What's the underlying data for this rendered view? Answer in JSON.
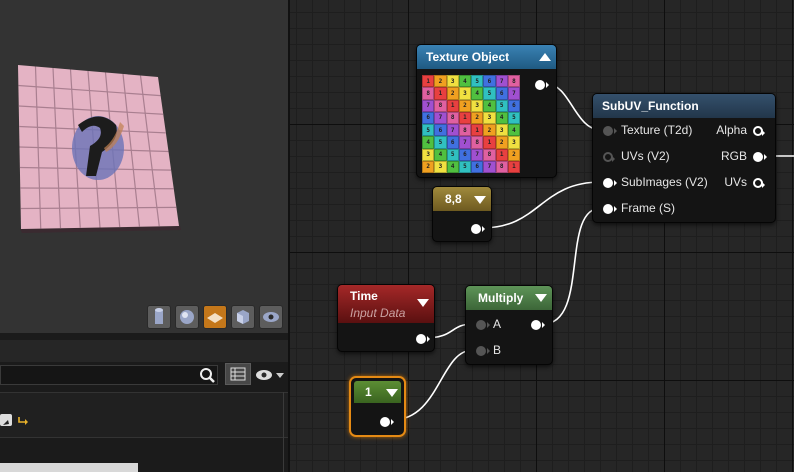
{
  "nodes": {
    "texture_object": {
      "title": "Texture Object"
    },
    "subuv": {
      "title": "SubUV_Function",
      "inputs": [
        "Texture (T2d)",
        "UVs (V2)",
        "SubImages (V2)",
        "Frame (S)"
      ],
      "outputs": [
        "Alpha",
        "RGB",
        "UVs"
      ]
    },
    "constant2": {
      "value": "8,8"
    },
    "time": {
      "title": "Time",
      "subtitle": "Input Data"
    },
    "multiply": {
      "title": "Multiply",
      "inputs": [
        "A",
        "B"
      ]
    },
    "constant1": {
      "value": "1"
    }
  },
  "texture_grid": [
    [
      "1",
      "2",
      "3",
      "4",
      "5",
      "6",
      "7",
      "8"
    ],
    [
      "8",
      "1",
      "2",
      "3",
      "4",
      "5",
      "6",
      "7"
    ],
    [
      "7",
      "8",
      "1",
      "2",
      "3",
      "4",
      "5",
      "6"
    ],
    [
      "6",
      "7",
      "8",
      "1",
      "2",
      "3",
      "4",
      "5"
    ],
    [
      "5",
      "6",
      "7",
      "8",
      "1",
      "2",
      "3",
      "4"
    ],
    [
      "4",
      "5",
      "6",
      "7",
      "8",
      "1",
      "2",
      "3"
    ],
    [
      "3",
      "4",
      "5",
      "6",
      "7",
      "8",
      "1",
      "2"
    ],
    [
      "2",
      "3",
      "4",
      "5",
      "6",
      "7",
      "8",
      "1"
    ]
  ],
  "texture_colors": [
    "#e84040",
    "#f0a020",
    "#f0e040",
    "#50c040",
    "#30c0c0",
    "#4070e0",
    "#a050d0",
    "#e060a0"
  ],
  "viewport": {
    "buttons": [
      "cylinder-icon",
      "sphere-icon",
      "plane-icon",
      "cube-icon",
      "custom-mesh-icon"
    ],
    "active": "plane-icon"
  },
  "colors": {
    "texture_title": "#2a6c98",
    "subuv_title": "#2b3f55",
    "constant2_title": "#8a7430",
    "time_title": "#8d1b1b",
    "multiply_title": "#4c7a48",
    "constant1_title": "#4b7a2a",
    "selection": "#e58a14"
  }
}
